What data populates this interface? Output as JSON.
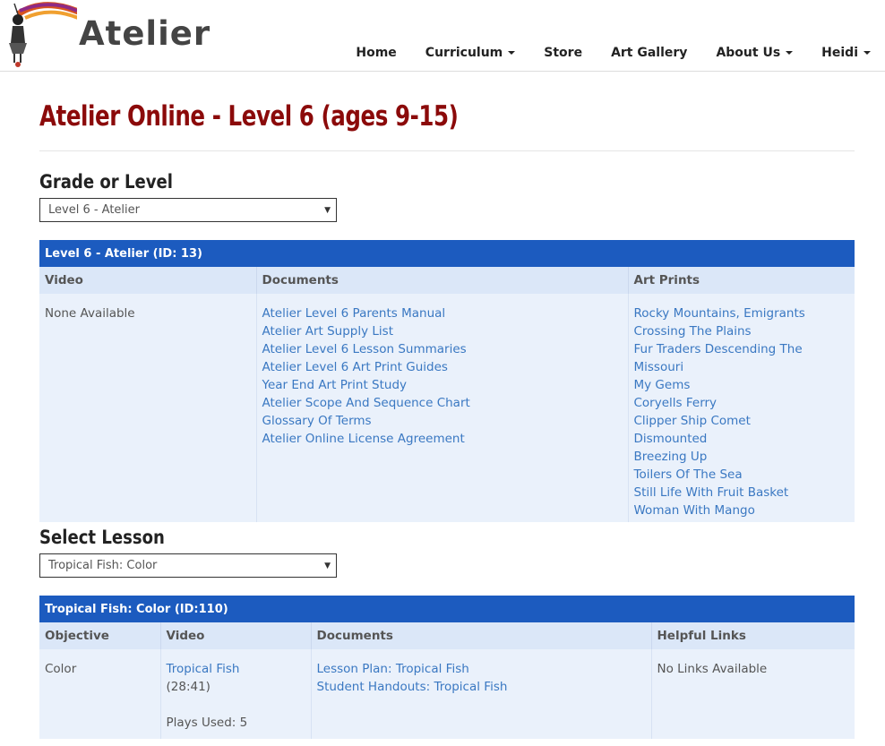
{
  "header": {
    "logo_text": "Atelier",
    "nav": [
      {
        "label": "Home",
        "dropdown": false
      },
      {
        "label": "Curriculum",
        "dropdown": true
      },
      {
        "label": "Store",
        "dropdown": false
      },
      {
        "label": "Art Gallery",
        "dropdown": false
      },
      {
        "label": "About Us",
        "dropdown": true
      },
      {
        "label": "Heidi",
        "dropdown": true
      }
    ]
  },
  "page": {
    "title": "Atelier Online - Level 6 (ages 9-15)"
  },
  "grade": {
    "heading": "Grade or Level",
    "selected": "Level 6 - Atelier"
  },
  "level_panel": {
    "title": "Level 6 - Atelier (ID: 13)",
    "columns": [
      "Video",
      "Documents",
      "Art Prints"
    ],
    "video": "None Available",
    "documents": [
      "Atelier Level 6 Parents Manual",
      "Atelier Art Supply List",
      "Atelier Level 6 Lesson Summaries",
      "Atelier Level 6 Art Print Guides",
      "Year End Art Print Study",
      "Atelier Scope And Sequence Chart",
      "Glossary Of Terms",
      "Atelier Online License Agreement"
    ],
    "art_prints": [
      "Rocky Mountains, Emigrants",
      "Crossing The Plains",
      "Fur Traders Descending The Missouri",
      "My Gems",
      "Coryells Ferry",
      "Clipper Ship Comet",
      "Dismounted",
      "Breezing Up",
      "Toilers Of The Sea",
      "Still Life With Fruit Basket",
      "Woman With Mango"
    ]
  },
  "lesson": {
    "heading": "Select Lesson",
    "selected": "Tropical Fish: Color"
  },
  "lesson_panel": {
    "title": "Tropical Fish: Color (ID:110)",
    "columns": [
      "Objective",
      "Video",
      "Documents",
      "Helpful Links"
    ],
    "objective": "Color",
    "video_title": "Tropical Fish",
    "video_duration": "(28:41)",
    "plays_used": "Plays Used: 5",
    "documents": [
      "Lesson Plan: Tropical Fish",
      "Student Handouts: Tropical Fish"
    ],
    "helpful_links": "No Links Available"
  },
  "colors": {
    "title_red": "#8b0a0a",
    "panel_blue": "#1c5bbf",
    "link_blue": "#3a78c2"
  }
}
